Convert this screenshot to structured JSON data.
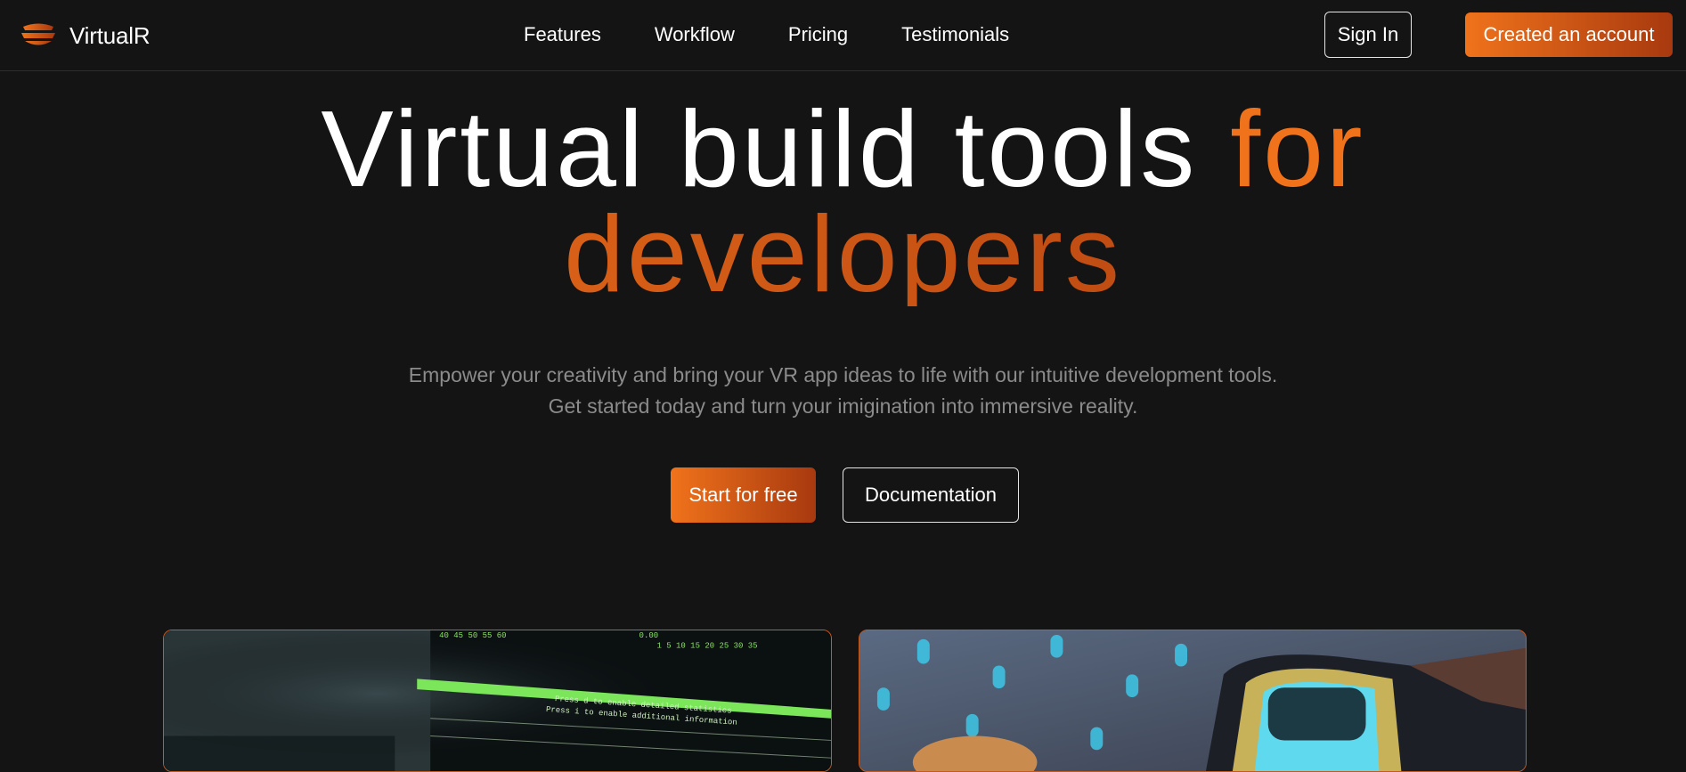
{
  "brand": {
    "name": "VirtualR",
    "logo_icon": "layered-stack-logo-icon",
    "accent_start": "#f0731b",
    "accent_end": "#a8390f",
    "background": "#141414"
  },
  "nav": {
    "links": [
      "Features",
      "Workflow",
      "Pricing",
      "Testimonials"
    ],
    "sign_in_label": "Sign In",
    "create_account_label": "Created an account"
  },
  "hero": {
    "title_white": "Virtual build tools",
    "title_accent_1": "for",
    "title_accent_2": "developers",
    "subtitle_line_1": "Empower your creativity and bring your VR app ideas to life with our intuitive development tools.",
    "subtitle_line_2": "Get started today and turn your imigination into immersive reality.",
    "primary_cta": "Start for free",
    "secondary_cta": "Documentation"
  },
  "cards": [
    {
      "image": "code-terminal-image",
      "terminal_lines": [
        "Press d to enable detailed statistics",
        "Press i to enable additional information"
      ]
    },
    {
      "image": "vr-headset-image"
    }
  ]
}
